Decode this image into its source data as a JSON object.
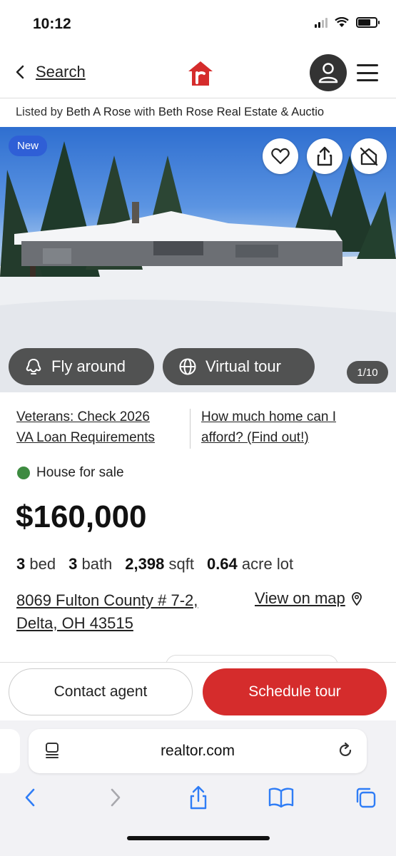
{
  "status_bar": {
    "time": "10:12"
  },
  "header": {
    "back_label": "Search"
  },
  "listing": {
    "listed_by_prefix": "Listed by",
    "agent": "Beth A Rose",
    "with": "with",
    "brokerage": "Beth Rose Real Estate & Auctio"
  },
  "photo": {
    "badge": "New",
    "fly_around": "Fly around",
    "virtual_tour": "Virtual tour",
    "counter": "1/10"
  },
  "promos": {
    "left_line1": "Veterans: Check 2026",
    "left_line2": "VA Loan Requirements",
    "right_line1": "How much home can I",
    "right_line2": "afford? (Find out!)"
  },
  "property": {
    "status": "House for sale",
    "price": "$160,000",
    "beds_value": "3",
    "beds_label": "bed",
    "baths_value": "3",
    "baths_label": "bath",
    "sqft_value": "2,398",
    "sqft_label": "sqft",
    "lot_value": "0.64",
    "lot_label": "acre lot",
    "address_line1": "8069 Fulton County # 7-2,",
    "address_line2": "Delta, OH 43515",
    "map_link": "View on map"
  },
  "actions": {
    "contact": "Contact agent",
    "schedule": "Schedule tour"
  },
  "browser": {
    "url": "realtor.com"
  },
  "colors": {
    "brand_red": "#d52c2c",
    "badge_blue": "#2f5fd6",
    "status_green": "#3d8b40"
  }
}
